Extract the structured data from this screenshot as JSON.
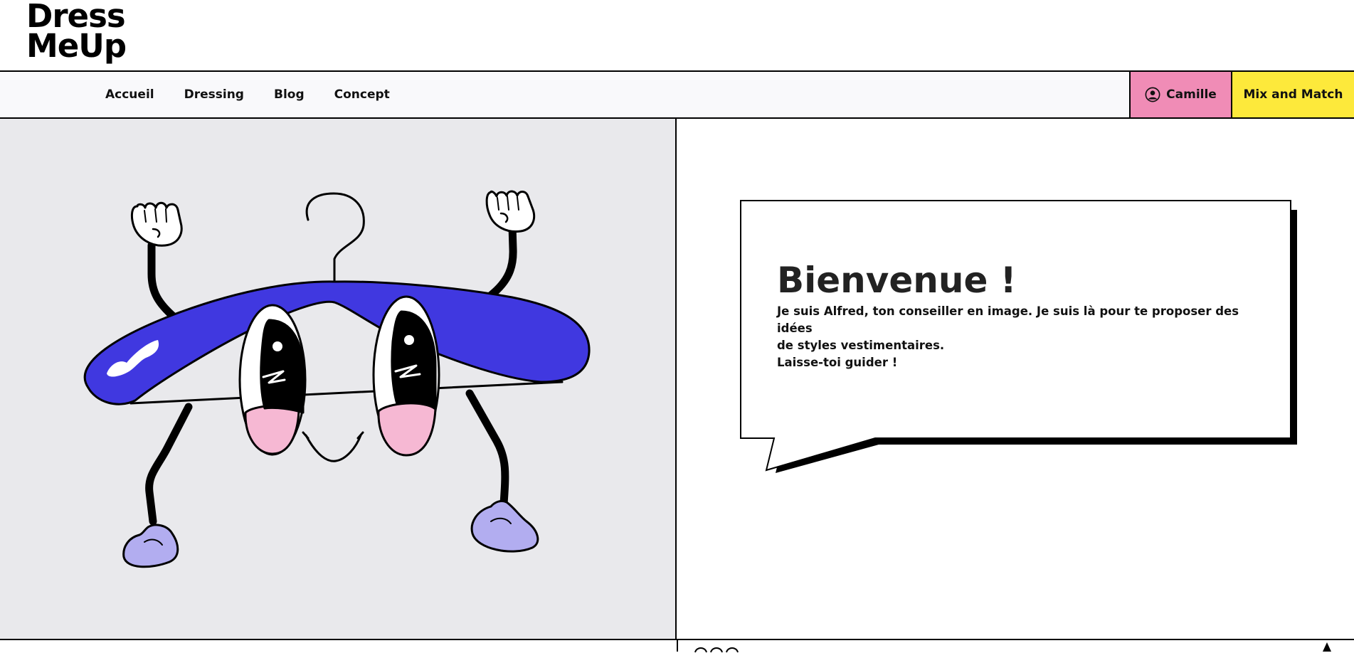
{
  "header": {
    "logo_line1": "Dress",
    "logo_line2": "MeUp"
  },
  "nav": {
    "links": [
      "Accueil",
      "Dressing",
      "Blog",
      "Concept"
    ],
    "user_label": "Camille",
    "mix_label": "Mix and Match"
  },
  "hero": {
    "mascot": "hanger-mascot",
    "bubble_title": "Bienvenue !",
    "bubble_line1": "Je suis Alfred, ton conseiller en image. Je suis là pour te proposer des idées",
    "bubble_line2": "de styles vestimentaires.",
    "bubble_line3": "Laisse-toi guider !"
  },
  "colors": {
    "user_button": "#f08cb6",
    "mix_button": "#fde93b",
    "hanger": "#4038e0",
    "shoes": "#b2adf0",
    "hero_bg": "#e9e9ec",
    "blush": "#f6b8d3"
  }
}
